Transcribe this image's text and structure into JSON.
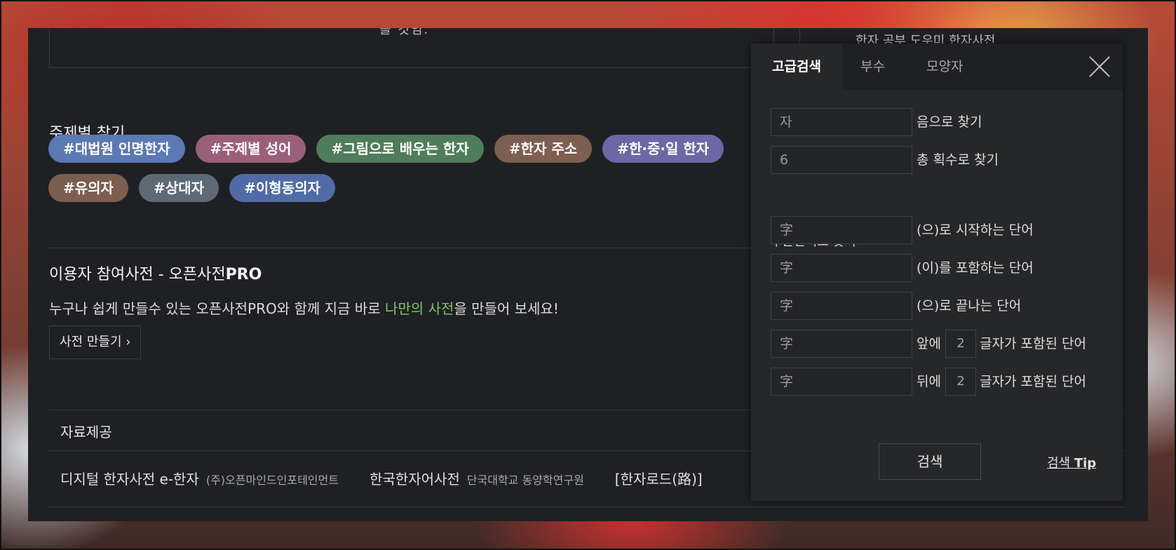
{
  "top": {
    "box_text": "를 것임.",
    "right_text": "한자 공부 도우미 한자사전"
  },
  "topic": {
    "title": "주제별 찾기",
    "tags": [
      {
        "label": "#대법원 인명한자",
        "color": "#5b79b3"
      },
      {
        "label": "#주제별 성어",
        "color": "#9a6079"
      },
      {
        "label": "#그림으로 배우는 한자",
        "color": "#4f7c5a"
      },
      {
        "label": "#한자 주소",
        "color": "#7d5e50"
      },
      {
        "label": "#한·중·일 한자",
        "color": "#6d67a6"
      },
      {
        "label": "#유의자",
        "color": "#7b5e4f"
      },
      {
        "label": "#상대자",
        "color": "#5d6a76"
      },
      {
        "label": "#이형동의자",
        "color": "#516ba6"
      }
    ]
  },
  "pro": {
    "title_prefix": "이용자 참여사전 - 오픈사전",
    "title_bold": "PRO",
    "desc_before": "누구나 쉽게 만들수 있는 오픈사전PRO와 함께 지금 바로 ",
    "desc_highlight": "나만의 사전",
    "desc_after": "을 만들어 보세요!",
    "button_label": "사전 만들기 ›"
  },
  "sources": {
    "title": "자료제공",
    "items": [
      {
        "name": "디지털 한자사전 e-한자",
        "publisher": "(주)오픈마인드인포테인먼트"
      },
      {
        "name": "한국한자어사전",
        "publisher": "단국대학교 동양학연구원"
      },
      {
        "name": "[한자로드(路)]",
        "publisher": ""
      }
    ]
  },
  "panel": {
    "tabs": [
      "고급검색",
      "부수",
      "모양자"
    ],
    "sound_field": {
      "value": "자",
      "label": "음으로 찾기"
    },
    "stroke_field": {
      "value": "6",
      "label": "총 획수로 찾기"
    },
    "partial_title": "부분단어로 찾기",
    "partial_rows": [
      {
        "value": "字",
        "label": "(으)로 시작하는 단어"
      },
      {
        "value": "字",
        "label": "(이)를 포함하는 단어"
      },
      {
        "value": "字",
        "label": "(으)로 끝나는 단어"
      }
    ],
    "count_rows": [
      {
        "value": "字",
        "prefix": "앞에",
        "count": "2",
        "suffix": "글자가 포함된 단어"
      },
      {
        "value": "字",
        "prefix": "뒤에",
        "count": "2",
        "suffix": "글자가 포함된 단어"
      }
    ],
    "search_button": "검색",
    "tip_text": "검색 ",
    "tip_bold": "Tip"
  }
}
